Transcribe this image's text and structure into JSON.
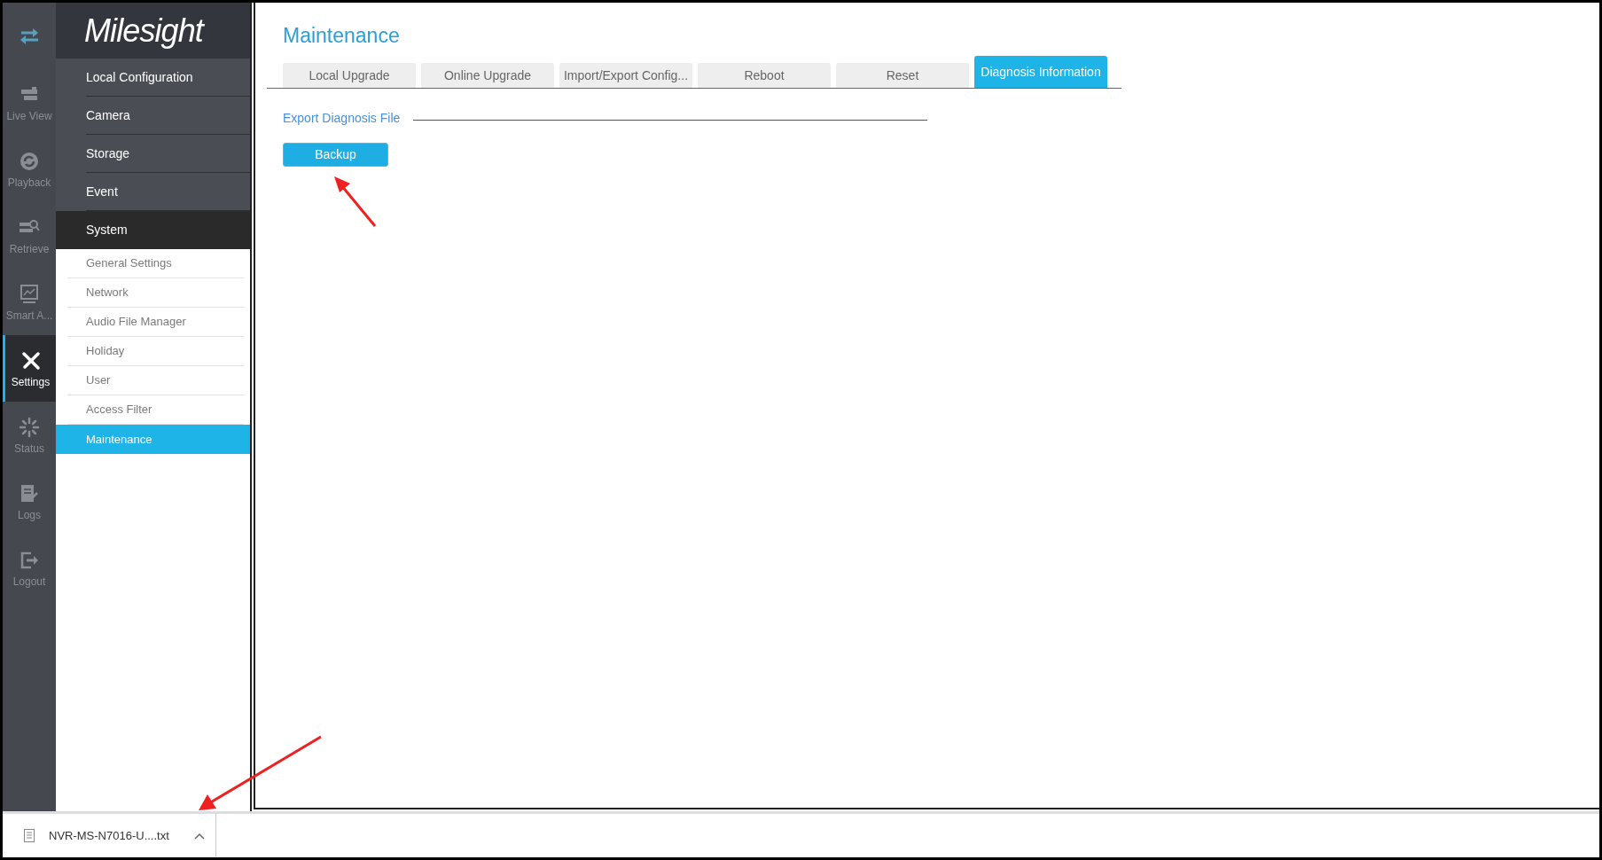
{
  "rail": [
    {
      "kind": "toggle",
      "selected": false
    },
    {
      "kind": "live",
      "label": "Live View",
      "selected": false
    },
    {
      "kind": "playback",
      "label": "Playback",
      "selected": false
    },
    {
      "kind": "retrieve",
      "label": "Retrieve",
      "selected": false
    },
    {
      "kind": "smart",
      "label": "Smart A...",
      "selected": false
    },
    {
      "kind": "settings",
      "label": "Settings",
      "selected": true
    },
    {
      "kind": "status",
      "label": "Status",
      "selected": false
    },
    {
      "kind": "logs",
      "label": "Logs",
      "selected": false
    },
    {
      "kind": "logout",
      "label": "Logout",
      "selected": false
    }
  ],
  "logo": "Milesight",
  "menu": [
    {
      "label": "Local Configuration",
      "expanded": false
    },
    {
      "label": "Camera",
      "expanded": false
    },
    {
      "label": "Storage",
      "expanded": false
    },
    {
      "label": "Event",
      "expanded": false
    },
    {
      "label": "System",
      "expanded": true,
      "children": [
        {
          "label": "General Settings",
          "selected": false
        },
        {
          "label": "Network",
          "selected": false
        },
        {
          "label": "Audio File Manager",
          "selected": false
        },
        {
          "label": "Holiday",
          "selected": false
        },
        {
          "label": "User",
          "selected": false
        },
        {
          "label": "Access Filter",
          "selected": false
        },
        {
          "label": "Maintenance",
          "selected": true
        }
      ]
    }
  ],
  "page_title": "Maintenance",
  "tabs": [
    {
      "label": "Local Upgrade",
      "selected": false
    },
    {
      "label": "Online Upgrade",
      "selected": false
    },
    {
      "label": "Import/Export Config...",
      "selected": false
    },
    {
      "label": "Reboot",
      "selected": false
    },
    {
      "label": "Reset",
      "selected": false
    },
    {
      "label": "Diagnosis Information",
      "selected": true
    }
  ],
  "section_title": "Export Diagnosis File",
  "button": "Backup",
  "download": {
    "file": "NVR-MS-N7016-U....txt"
  }
}
